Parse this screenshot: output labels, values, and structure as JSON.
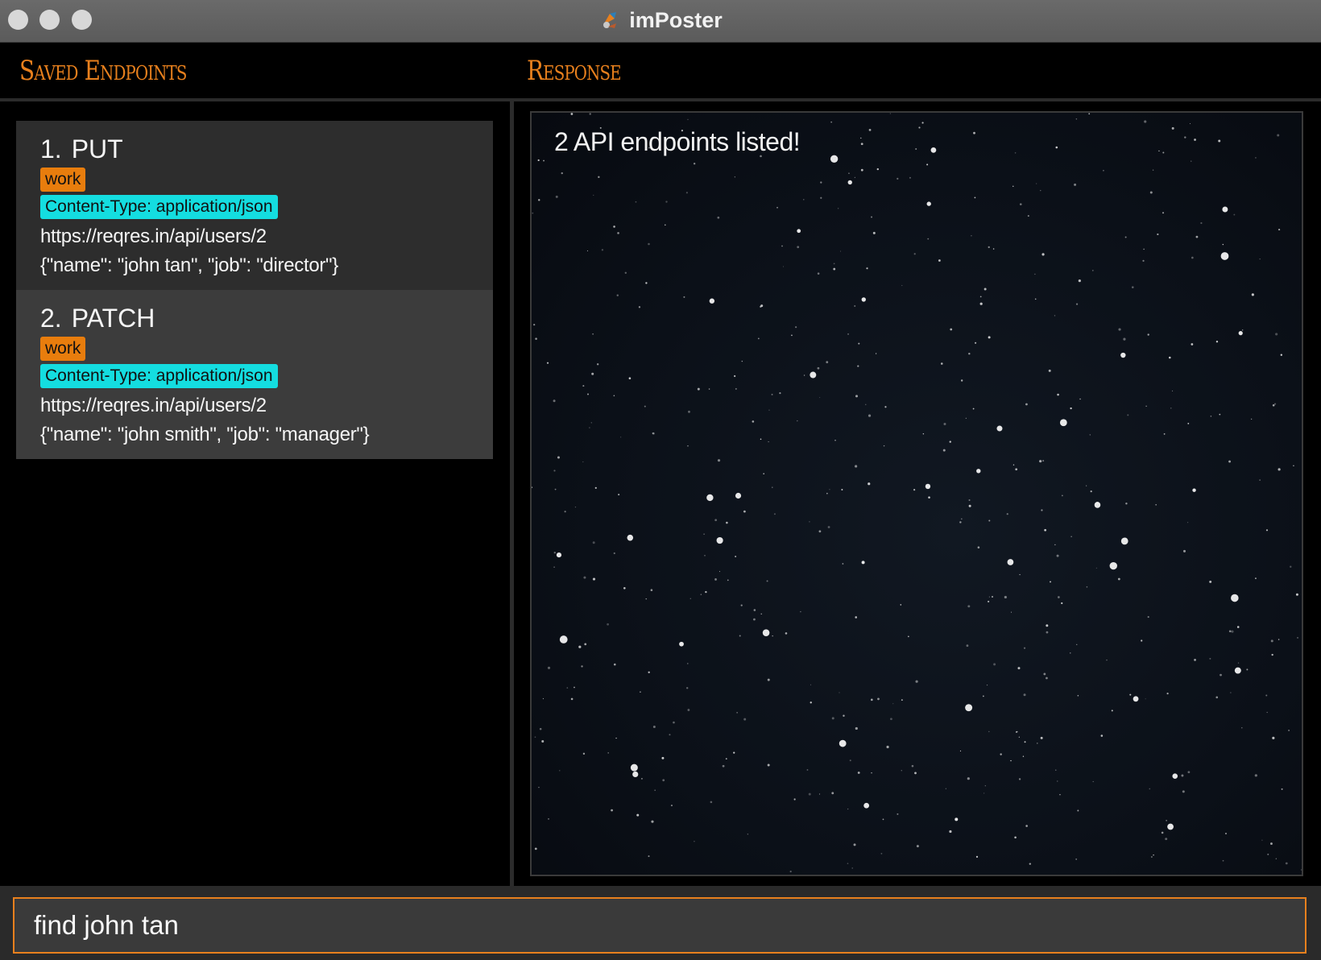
{
  "window": {
    "title": "imPoster",
    "icon": "imposter-logo-icon"
  },
  "headers": {
    "left": "Saved Endpoints",
    "right": "Response"
  },
  "endpoints": [
    {
      "index": "1.",
      "method": "PUT",
      "tag": "work",
      "header": "Content-Type: application/json",
      "url": "https://reqres.in/api/users/2",
      "body": "{\"name\": \"john tan\", \"job\": \"director\"}"
    },
    {
      "index": "2.",
      "method": "PATCH",
      "tag": "work",
      "header": "Content-Type: application/json",
      "url": "https://reqres.in/api/users/2",
      "body": "{\"name\": \"john smith\", \"job\": \"manager\"}"
    }
  ],
  "response": {
    "message": "2 API endpoints listed!"
  },
  "command": {
    "value": "find john tan"
  },
  "colors": {
    "accent": "#e8801d",
    "tag": "#e87d0d",
    "header_badge": "#14dde0"
  }
}
